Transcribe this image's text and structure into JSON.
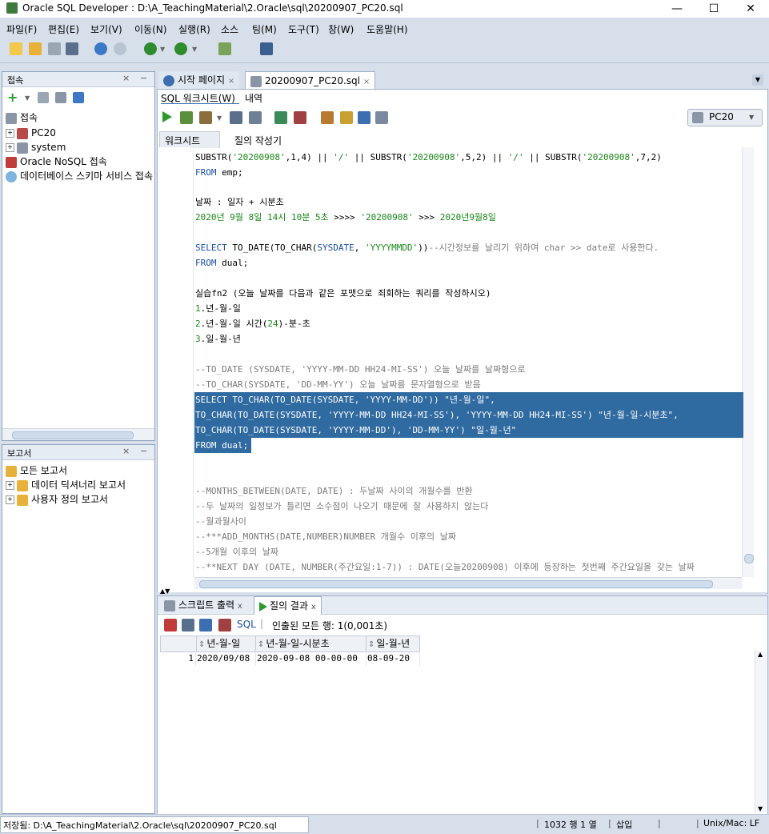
{
  "window": {
    "title": "Oracle SQL Developer : D:\\A_TeachingMaterial\\2.Oracle\\sql\\20200907_PC20.sql",
    "minimize": "—",
    "maximize": "☐",
    "close": "✕"
  },
  "menu": [
    "파일(F)",
    "편집(E)",
    "보기(V)",
    "이동(N)",
    "실행(R)",
    "소스",
    "팀(M)",
    "도구(T)",
    "창(W)",
    "도움말(H)"
  ],
  "connections_panel": {
    "title": "접속",
    "root": "접속",
    "items": [
      "PC20",
      "system",
      "Oracle NoSQL 접속",
      "데이터베이스 스키마 서비스 접속"
    ]
  },
  "reports_panel": {
    "title": "보고서",
    "items": [
      "모든 보고서",
      "데이터 딕셔너리 보고서",
      "사용자 정의 보고서"
    ]
  },
  "editor": {
    "tabs": [
      "시작 페이지",
      "20200907_PC20.sql"
    ],
    "subtabs": [
      "SQL 워크시트(W)",
      "내역"
    ],
    "connection": "PC20",
    "worksheet_tabs": [
      "워크시트",
      "질의 작성기"
    ]
  },
  "output": {
    "tabs": [
      "스크립트 출력",
      "질의 결과"
    ],
    "sql_link": "SQL",
    "fetch_status": "인출된 모든 행: 1(0,001초)",
    "columns": [
      "년-월-일",
      "년-월-일-시분초",
      "일-월-년"
    ],
    "rows": [
      {
        "num": "1",
        "cells": [
          "2020/09/08",
          "2020-09-08 00-00-00",
          "08-09-20"
        ]
      }
    ]
  },
  "status": {
    "file": "저장됨: D:\\A_TeachingMaterial\\2.Oracle\\sql\\20200907_PC20.sql",
    "position": "1032 행 1 열",
    "mode": "삽입",
    "line_endings": "Unix/Mac: LF"
  },
  "colors": {
    "selection": "#2f6aa0",
    "keyword": "#1a4fa3",
    "string": "#1a8a1a",
    "comment": "#7a7a7a"
  }
}
